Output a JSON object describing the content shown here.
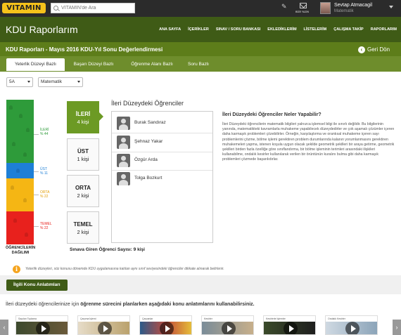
{
  "topbar": {
    "logo": "VITAMIN",
    "search_placeholder": "VİTAMİN'de Ara",
    "mail_label": "BİZE YAZIN",
    "user_name": "Sevtap Atmacagil",
    "user_role": "Matematik"
  },
  "header": {
    "title": "KDU Raporlarım",
    "nav": [
      "ANA SAYFA",
      "İÇERİKLER",
      "SINAV / SORU BANKASI",
      "EKLEDİKLERİM",
      "LİSTELERİM",
      "ÇALIŞMA TAKİP",
      "RAPORLARIM"
    ]
  },
  "report": {
    "title": "KDU Raporları - Mayıs 2016 KDU-Yıl Sonu Değerlendirmesi",
    "back_label": "Geri Dön"
  },
  "tabs": [
    "Yeterlik Düzeyi Bazlı",
    "Başarı Düzeyi Bazlı",
    "Öğrenme Alanı Bazlı",
    "Soru Bazlı"
  ],
  "filters": {
    "class": "5A",
    "subject": "Matematik"
  },
  "distribution": {
    "caption": "ÖĞRENCİLERİN DAĞILIMI",
    "levels": [
      {
        "name": "İLERİ",
        "percent": "% 44",
        "color": "#2e9b3a",
        "label_color": "#2e9b3a"
      },
      {
        "name": "ÜST",
        "percent": "% 11",
        "color": "#1e7fd6",
        "label_color": "#1e7fd6"
      },
      {
        "name": "ORTA",
        "percent": "% 22",
        "color": "#f5b614",
        "label_color": "#e39c00"
      },
      {
        "name": "TEMEL",
        "percent": "% 22",
        "color": "#e8211d",
        "label_color": "#e8211d"
      }
    ]
  },
  "level_cards": [
    {
      "name": "İLERİ",
      "count": "4 kişi"
    },
    {
      "name": "ÜST",
      "count": "1 kişi"
    },
    {
      "name": "ORTA",
      "count": "2 kişi"
    },
    {
      "name": "TEMEL",
      "count": "2 kişi"
    }
  ],
  "students": {
    "heading": "İleri Düzeydeki Öğrenciler",
    "list": [
      "Burak Sandıraz",
      "Şehnaz Yakar",
      "Özgür Arda",
      "Tolga Bozkurt"
    ]
  },
  "description": {
    "heading": "İleri Düzeydeki Öğrenciler Neler Yapabilir?",
    "text": "İleri Düzeydeki öğrencilerin matematik bilgileri yalnızca işlemsel bilgi ile sınırlı değildir. Bu bilgilerinin yanında, matematikteki kavramlarla muhakeme yapabilecek düzeydedirler ve çok aşamalı çözümler içeren daha karmaşık problemleri çözebilirler. Örneğin, karşılaştırma ve orantısal muhakeme içeren sayı problemlerini çözme, bölme işlemi gerektiren problem durumlarında kalanın yorumlanmasını gerektiren muhakemeleri yapma, istenen koşula uygun olacak şekilde geometrik şekilleri bir araya getirme, geometrik şekilleri birden fazla özelliğe göre sınıflandırma, bir bölme işleminin terimleri arasındaki ilişkileri kullanabilme, ondalık kesirler kullanılarak verilen bir örüntünün kuralını bulma gibi daha karmaşık problemleri çözmede başarılıdırlar."
  },
  "total_label": "Sınava Giren Öğrenci Sayısı: 9 kişi",
  "info_text": "Yeterlik düzeyleri, söz konusu dönemde KDU uygulamasına katılan aynı sınıf seviyesindeki öğrenciler dikkate alınarak belirlenir.",
  "related_button": "İlgili Konu Anlatımları",
  "note_prefix": "İleri düzeydeki öğrencilerinize için ",
  "note_bold": "öğrenme sürecini planlarken aşağıdaki konu anlatımlarını kullanabilirsiniz.",
  "thumbnails": [
    "Sayıları Toplama",
    "Çarpma İşlemi",
    "Çarpanlar",
    "Kesirler",
    "Kesirlerle İşlemler",
    "Ondalık Kesirler"
  ]
}
